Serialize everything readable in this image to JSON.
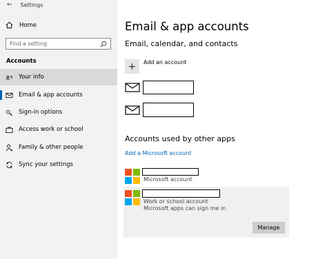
{
  "window": {
    "title": "Settings",
    "back_glyph": "←"
  },
  "sidebar": {
    "home_label": "Home",
    "search_placeholder": "Find a setting",
    "section": "Accounts",
    "items": [
      {
        "label": "Your info",
        "icon": "person-card-icon"
      },
      {
        "label": "Email & app accounts",
        "icon": "mail-icon"
      },
      {
        "label": "Sign-in options",
        "icon": "key-icon"
      },
      {
        "label": "Access work or school",
        "icon": "briefcase-icon"
      },
      {
        "label": "Family & other people",
        "icon": "person-add-icon"
      },
      {
        "label": "Sync your settings",
        "icon": "sync-icon"
      }
    ]
  },
  "main": {
    "title": "Email & app accounts",
    "email_section": "Email, calendar, and contacts",
    "add_account": "Add an account",
    "other_apps_section": "Accounts used by other apps",
    "add_ms_account": "Add a Microsoft account",
    "accounts": [
      {
        "type_label": "Microsoft account"
      },
      {
        "type_label": "Work or school account",
        "detail": "Microsoft apps can sign me in",
        "manage_label": "Manage"
      }
    ]
  },
  "colors": {
    "accent": "#0063b1",
    "ms_red": "#f25022",
    "ms_green": "#7fba00",
    "ms_blue": "#00a4ef",
    "ms_yellow": "#ffb900"
  }
}
